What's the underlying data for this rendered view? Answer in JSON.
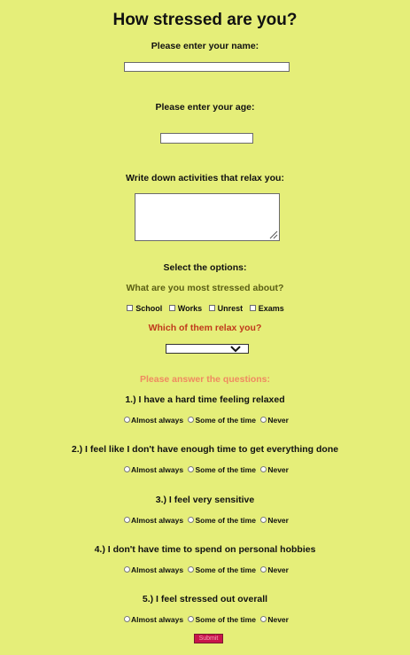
{
  "title": "How stressed are you?",
  "name_label": "Please enter your name:",
  "age_label": "Please enter your age:",
  "activities_label": "Write down activities that relax you:",
  "options_label": "Select the options:",
  "stressed_question": "What are you most stressed about?",
  "checkboxes": [
    "School",
    "Works",
    "Unrest",
    "Exams"
  ],
  "relax_question": "Which of them relax you?",
  "answer_prompt": "Please answer the questions:",
  "questions": [
    "1.) I have a hard time feeling relaxed",
    "2.) I feel like I don't have enough time to get everything done",
    "3.) I feel very sensitive",
    "4.) I don't have time to spend on personal hobbies",
    "5.) I feel stressed out overall"
  ],
  "radio_options": [
    "Almost always",
    "Some of the time",
    "Never"
  ],
  "submit_label": "Submit",
  "colors": {
    "background": "#e5ee79",
    "stressed_question": "#5b5f14",
    "relax_question": "#c0391b",
    "answer_prompt": "#ef8a61",
    "submit_bg": "#c8154a"
  },
  "icons": {
    "select_arrow": "chevron-down-icon",
    "textarea_resize": "resize-grip-icon"
  }
}
